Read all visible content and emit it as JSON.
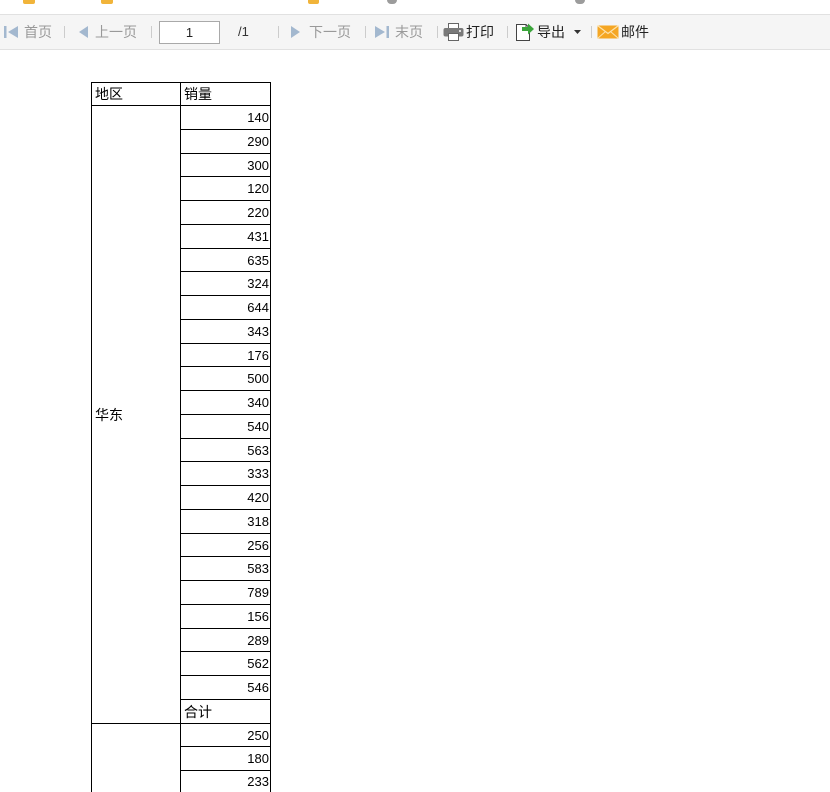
{
  "toolbar": {
    "first_page": {
      "label": "首页",
      "icon": "first-page-icon",
      "enabled": false
    },
    "prev_page": {
      "label": "上一页",
      "icon": "prev-page-icon",
      "enabled": false
    },
    "page_input": {
      "value": "1"
    },
    "page_total": "/1",
    "next_page": {
      "label": "下一页",
      "icon": "next-page-icon",
      "enabled": false
    },
    "last_page": {
      "label": "末页",
      "icon": "last-page-icon",
      "enabled": false
    },
    "print": {
      "label": "打印",
      "icon": "printer-icon"
    },
    "export": {
      "label": "导出",
      "icon": "export-icon",
      "dropdown_icon": "caret-down-icon"
    },
    "mail": {
      "label": "邮件",
      "icon": "mail-icon"
    }
  },
  "colors": {
    "toolbar_bg": "#f5f5f5",
    "toolbar_border": "#e1e1e1",
    "disabled_text": "#999999",
    "disabled_icon": "#a3b8cf",
    "enabled_text": "#222222",
    "export_arrow": "#3ba53b",
    "mail": "#f5a623",
    "grid_line": "#000000",
    "separator": "#cccccc"
  },
  "report": {
    "headers": {
      "region": "地区",
      "sales": "销量"
    },
    "groups": [
      {
        "region": "华东",
        "sales": [
          140,
          290,
          300,
          120,
          220,
          431,
          635,
          324,
          644,
          343,
          176,
          500,
          340,
          540,
          563,
          333,
          420,
          318,
          256,
          583,
          789,
          156,
          289,
          562,
          546
        ],
        "subtotal_label": "合计"
      },
      {
        "sales": [
          250,
          180,
          233
        ]
      }
    ]
  }
}
